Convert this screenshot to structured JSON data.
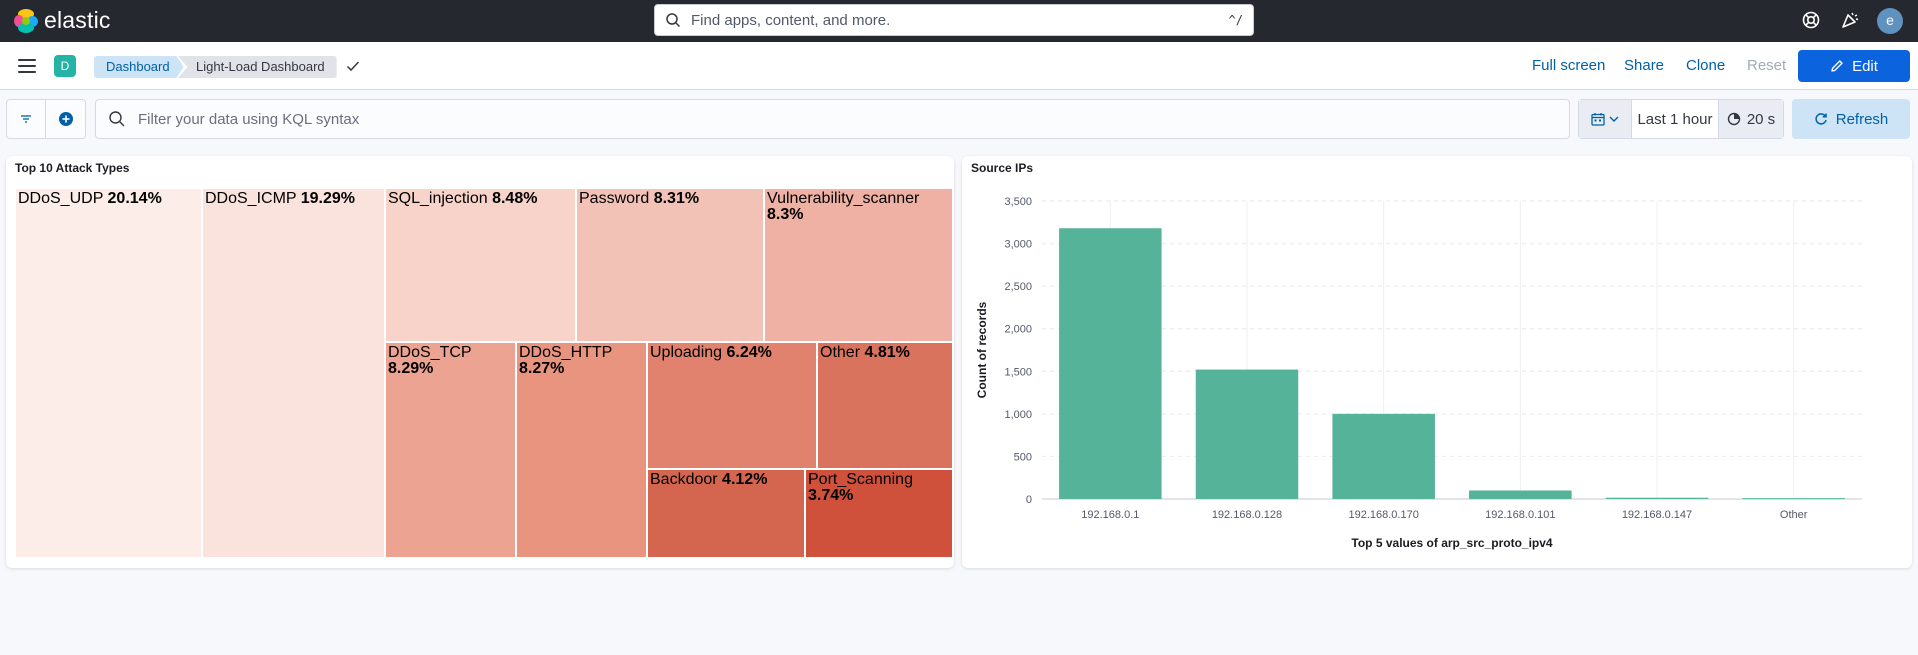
{
  "header": {
    "brand": "elastic",
    "search_placeholder": "Find apps, content, and more.",
    "search_shortcut": "^/",
    "avatar_initial": "e"
  },
  "nav": {
    "space_initial": "D",
    "breadcrumbs": [
      "Dashboard",
      "Light-Load Dashboard"
    ],
    "actions": {
      "full_screen": "Full screen",
      "share": "Share",
      "clone": "Clone",
      "reset": "Reset",
      "edit": "Edit"
    }
  },
  "filterbar": {
    "kql_placeholder": "Filter your data using KQL syntax",
    "time_range": "Last 1 hour",
    "refresh_interval": "20 s",
    "refresh_label": "Refresh"
  },
  "treemap": {
    "title": "Top 10 Attack Types",
    "cells": [
      {
        "label": "DDoS_UDP",
        "pct": "20.14%",
        "color": "#fcede9"
      },
      {
        "label": "DDoS_ICMP",
        "pct": "19.29%",
        "color": "#fae3dd"
      },
      {
        "label": "SQL_injection",
        "pct": "8.48%",
        "color": "#f7d3ca"
      },
      {
        "label": "Password",
        "pct": "8.31%",
        "color": "#f3c2b6"
      },
      {
        "label": "Vulnerability_scanner",
        "pct": "8.3%",
        "color": "#efb1a3"
      },
      {
        "label": "DDoS_TCP",
        "pct": "8.29%",
        "color": "#eca391"
      },
      {
        "label": "DDoS_HTTP",
        "pct": "8.27%",
        "color": "#e8947f"
      },
      {
        "label": "Uploading",
        "pct": "6.24%",
        "color": "#e0826d"
      },
      {
        "label": "Other",
        "pct": "4.81%",
        "color": "#da735e"
      },
      {
        "label": "Backdoor",
        "pct": "4.12%",
        "color": "#d4664f"
      },
      {
        "label": "Port_Scanning",
        "pct": "3.74%",
        "color": "#cf513b"
      }
    ]
  },
  "bar_panel": {
    "title": "Source IPs"
  },
  "chart_data": {
    "type": "bar",
    "categories": [
      "192.168.0.1",
      "192.168.0.128",
      "192.168.0.170",
      "192.168.0.101",
      "192.168.0.147",
      "Other"
    ],
    "values": [
      3180,
      1520,
      1000,
      100,
      15,
      10
    ],
    "xlabel": "Top 5 values of arp_src_proto_ipv4",
    "ylabel": "Count of records",
    "ylim": [
      0,
      3500
    ],
    "yticks": [
      "0",
      "500",
      "1,000",
      "1,500",
      "2,000",
      "2,500",
      "3,000",
      "3,500"
    ],
    "color": "#54b399",
    "grid": true
  }
}
